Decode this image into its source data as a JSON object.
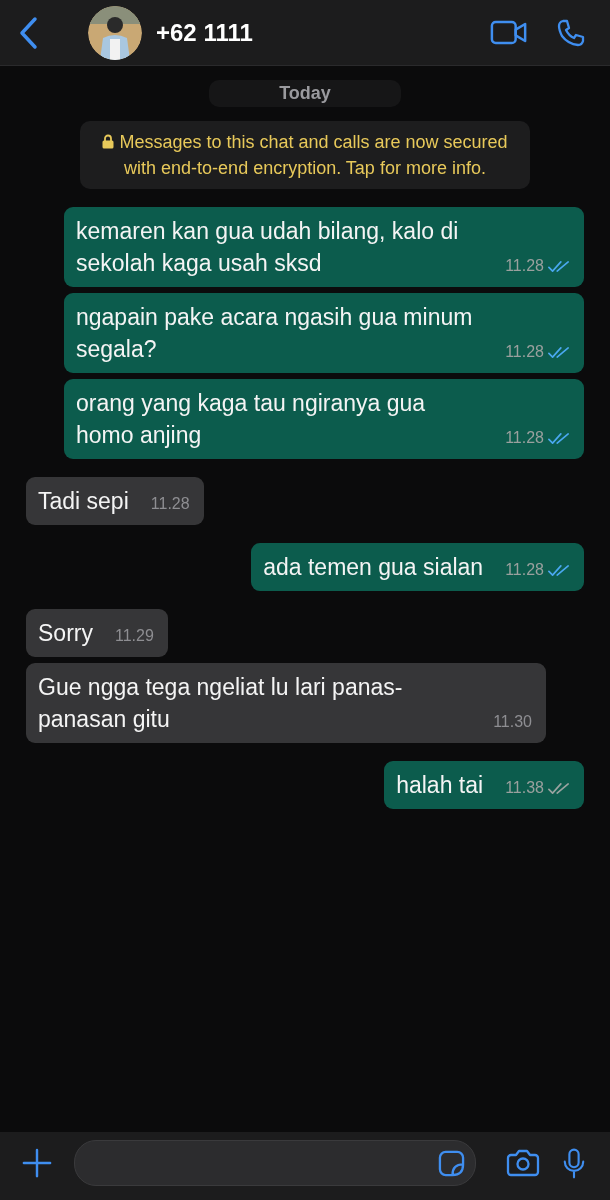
{
  "header": {
    "contact_name": "+62 1111"
  },
  "date_label": "Today",
  "encryption_notice": "Messages to this chat and calls are now secured with end-to-end encryption. Tap for more info.",
  "messages": [
    {
      "kind": "sent",
      "text": "kemaren kan gua udah bilang, kalo di sekolah kaga usah sksd",
      "time": "11.28",
      "read": true
    },
    {
      "kind": "sent",
      "text": "ngapain pake acara ngasih gua minum segala?",
      "time": "11.28",
      "read": true
    },
    {
      "kind": "sent",
      "text": "orang yang kaga tau ngiranya gua homo anjing",
      "time": "11.28",
      "read": true
    },
    {
      "kind": "received",
      "text": "Tadi sepi",
      "time": "11.28"
    },
    {
      "kind": "sent",
      "text": "ada temen gua sialan",
      "time": "11.28",
      "read": true
    },
    {
      "kind": "received",
      "text": "Sorry",
      "time": "11.29"
    },
    {
      "kind": "received",
      "text": "Gue ngga tega ngeliat lu lari panas-panasan gitu",
      "time": "11.30"
    },
    {
      "kind": "sent",
      "text": "halah tai",
      "time": "11.38",
      "read": false
    }
  ]
}
